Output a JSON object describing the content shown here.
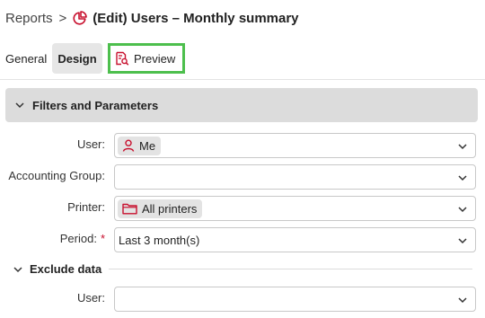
{
  "header": {
    "breadcrumb_root": "Reports",
    "separator": ">",
    "report_icon": "pie-chart-icon",
    "title": "(Edit) Users – Monthly summary"
  },
  "tabs": [
    {
      "label": "General",
      "active": false
    },
    {
      "label": "Design",
      "active": true
    },
    {
      "label": "Preview",
      "icon": "document-search-icon",
      "highlighted": true
    }
  ],
  "sections": {
    "filters": {
      "title": "Filters and Parameters",
      "expanded": true,
      "fields": [
        {
          "label": "User:",
          "value": "Me",
          "chip_icon": "user-icon",
          "required": false
        },
        {
          "label": "Accounting Group:",
          "value": "",
          "required": false
        },
        {
          "label": "Printer:",
          "value": "All printers",
          "chip_icon": "folder-icon",
          "required": false
        },
        {
          "label": "Period:",
          "value": "Last 3 month(s)",
          "required": true,
          "required_mark": "*"
        }
      ]
    },
    "exclude": {
      "title": "Exclude data",
      "expanded": true,
      "fields": [
        {
          "label": "User:",
          "value": ""
        }
      ]
    }
  },
  "colors": {
    "accent_red": "#c8102e",
    "highlight_green": "#4dbf4d",
    "section_bg": "#dcdcdc",
    "chip_bg": "#e3e3e3"
  }
}
